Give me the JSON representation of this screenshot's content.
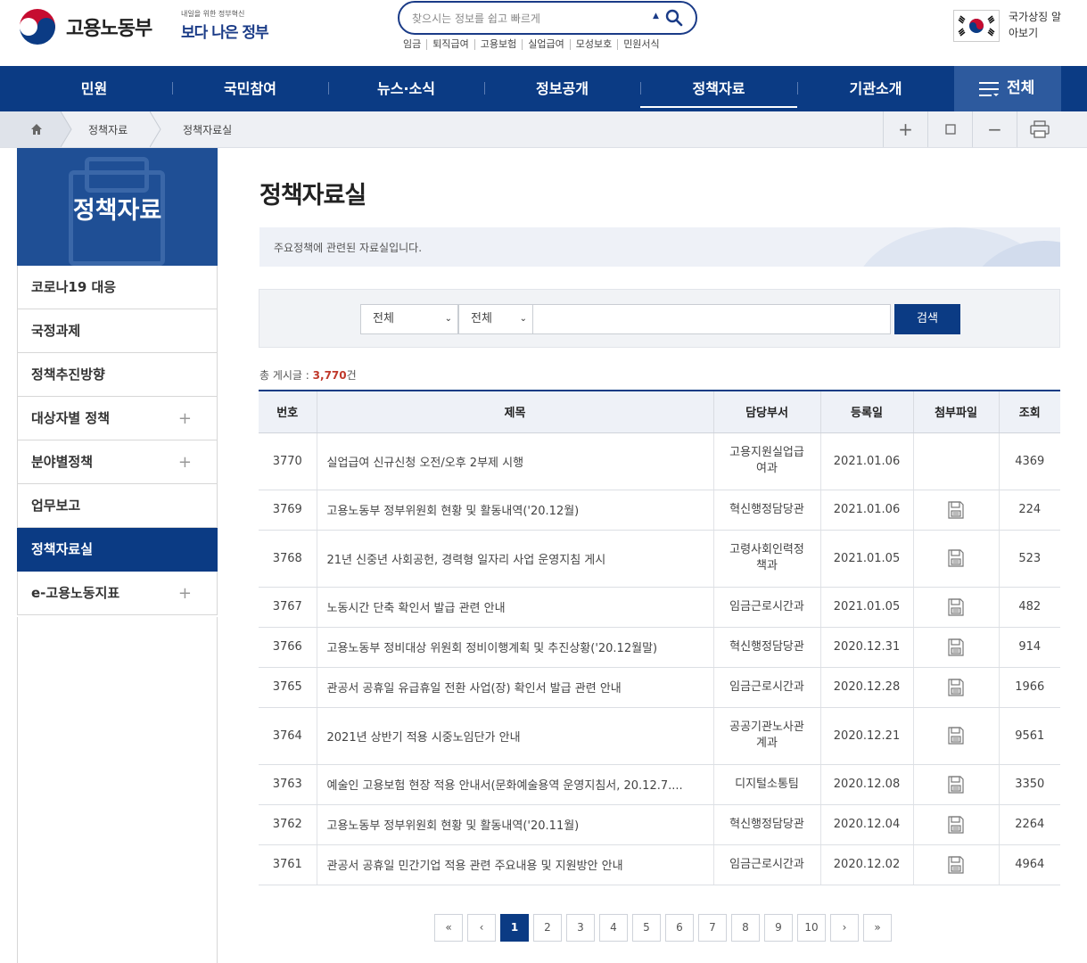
{
  "header": {
    "ministry_name": "고용노동부",
    "slogan_small": "내일을 위한 정부혁신",
    "slogan_big": "보다 나은 정부",
    "search_placeholder": "찾으시는 정보를 쉽고 빠르게",
    "quick_links": [
      "임금",
      "퇴직급여",
      "고용보험",
      "실업급여",
      "모성보호",
      "민원서식"
    ],
    "nation_label": "국가상징 알아보기"
  },
  "nav": {
    "items": [
      "민원",
      "국민참여",
      "뉴스·소식",
      "정보공개",
      "정책자료",
      "기관소개"
    ],
    "active_index": 4,
    "all_label": "전체"
  },
  "breadcrumb": {
    "items": [
      "정책자료",
      "정책자료실"
    ]
  },
  "sidebar": {
    "title": "정책자료",
    "items": [
      {
        "label": "코로나19 대응",
        "expandable": false,
        "active": false
      },
      {
        "label": "국정과제",
        "expandable": false,
        "active": false
      },
      {
        "label": "정책추진방향",
        "expandable": false,
        "active": false
      },
      {
        "label": "대상자별 정책",
        "expandable": true,
        "active": false
      },
      {
        "label": "분야별정책",
        "expandable": true,
        "active": false
      },
      {
        "label": "업무보고",
        "expandable": false,
        "active": false
      },
      {
        "label": "정책자료실",
        "expandable": false,
        "active": true
      },
      {
        "label": "e-고용노동지표",
        "expandable": true,
        "active": false
      }
    ]
  },
  "main": {
    "title": "정책자료실",
    "intro": "주요정책에 관련된 자료실입니다.",
    "search": {
      "select1": "전체",
      "select2": "전체",
      "keyword": "",
      "button": "검색"
    },
    "total_label": "총 게시글 :",
    "total_count": "3,770",
    "total_unit": "건",
    "table": {
      "headers": [
        "번호",
        "제목",
        "담당부서",
        "등록일",
        "첨부파일",
        "조회"
      ],
      "rows": [
        {
          "no": "3770",
          "title": "실업급여 신규신청 오전/오후 2부제 시행",
          "dept": "고용지원실업급여과",
          "date": "2021.01.06",
          "file": false,
          "views": "4369"
        },
        {
          "no": "3769",
          "title": "고용노동부 정부위원회 현황 및 활동내역('20.12월)",
          "dept": "혁신행정담당관",
          "date": "2021.01.06",
          "file": true,
          "views": "224"
        },
        {
          "no": "3768",
          "title": "21년 신중년 사회공헌, 경력형 일자리 사업 운영지침 게시",
          "dept": "고령사회인력정책과",
          "date": "2021.01.05",
          "file": true,
          "views": "523"
        },
        {
          "no": "3767",
          "title": "노동시간 단축 확인서 발급 관련 안내",
          "dept": "임금근로시간과",
          "date": "2021.01.05",
          "file": true,
          "views": "482"
        },
        {
          "no": "3766",
          "title": "고용노동부 정비대상 위원회 정비이행계획 및 추진상황('20.12월말)",
          "dept": "혁신행정담당관",
          "date": "2020.12.31",
          "file": true,
          "views": "914"
        },
        {
          "no": "3765",
          "title": "관공서 공휴일 유급휴일 전환 사업(장) 확인서 발급 관련 안내",
          "dept": "임금근로시간과",
          "date": "2020.12.28",
          "file": true,
          "views": "1966"
        },
        {
          "no": "3764",
          "title": "2021년 상반기 적용 시중노임단가 안내",
          "dept": "공공기관노사관계과",
          "date": "2020.12.21",
          "file": true,
          "views": "9561"
        },
        {
          "no": "3763",
          "title": "예술인 고용보험 현장 적용 안내서(문화예술용역 운영지침서, 20.12.7....",
          "dept": "디지털소통팀",
          "date": "2020.12.08",
          "file": true,
          "views": "3350"
        },
        {
          "no": "3762",
          "title": "고용노동부 정부위원회 현황 및 활동내역('20.11월)",
          "dept": "혁신행정담당관",
          "date": "2020.12.04",
          "file": true,
          "views": "2264"
        },
        {
          "no": "3761",
          "title": "관공서 공휴일 민간기업 적용 관련 주요내용 및 지원방안 안내",
          "dept": "임금근로시간과",
          "date": "2020.12.02",
          "file": true,
          "views": "4964"
        }
      ]
    },
    "pagination": {
      "first": "«",
      "prev": "‹",
      "pages": [
        "1",
        "2",
        "3",
        "4",
        "5",
        "6",
        "7",
        "8",
        "9",
        "10"
      ],
      "current": "1",
      "next": "›",
      "last": "»"
    }
  },
  "colors": {
    "primary": "#0b3b84",
    "accent_count": "#c0392b"
  }
}
